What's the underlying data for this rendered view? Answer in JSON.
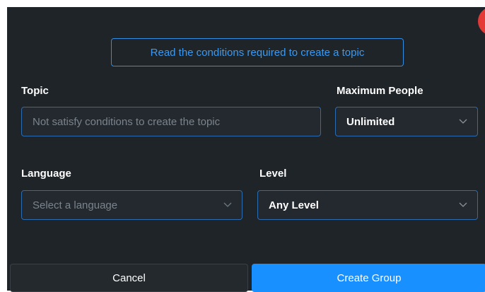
{
  "dialog": {
    "conditions_link": "Read the conditions required to create a topic",
    "close_label": "X"
  },
  "form": {
    "topic": {
      "label": "Topic",
      "placeholder": "Not satisfy conditions to create the topic"
    },
    "max_people": {
      "label": "Maximum People",
      "value": "Unlimited"
    },
    "language": {
      "label": "Language",
      "placeholder": "Select a language"
    },
    "level": {
      "label": "Level",
      "value": "Any Level"
    }
  },
  "actions": {
    "cancel_label": "Cancel",
    "create_label": "Create Group"
  },
  "colors": {
    "background": "#1f2428",
    "accent": "#1890ff",
    "field_border": "#2b6cb0",
    "close": "#e53935"
  }
}
